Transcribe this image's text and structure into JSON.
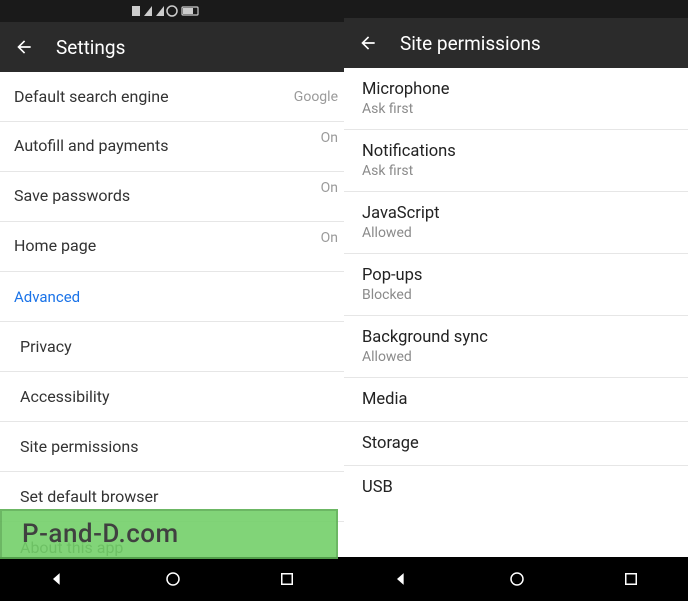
{
  "left": {
    "title": "Settings",
    "rows": [
      {
        "label": "Default search engine",
        "value": "Google"
      },
      {
        "label": "Autofill and payments",
        "value": "On"
      },
      {
        "label": "Save passwords",
        "value": "On"
      },
      {
        "label": "Home page",
        "value": "On"
      }
    ],
    "section": "Advanced",
    "advanced": [
      "Privacy",
      "Accessibility",
      "Site permissions",
      "Set default browser",
      "About this app"
    ]
  },
  "right": {
    "title": "Site permissions",
    "items": [
      {
        "label": "Microphone",
        "sub": "Ask first"
      },
      {
        "label": "Notifications",
        "sub": "Ask first"
      },
      {
        "label": "JavaScript",
        "sub": "Allowed"
      },
      {
        "label": "Pop-ups",
        "sub": "Blocked"
      },
      {
        "label": "Background sync",
        "sub": "Allowed"
      },
      {
        "label": "Media",
        "sub": ""
      },
      {
        "label": "Storage",
        "sub": ""
      },
      {
        "label": "USB",
        "sub": ""
      }
    ]
  },
  "watermark": "P-and-D.com"
}
